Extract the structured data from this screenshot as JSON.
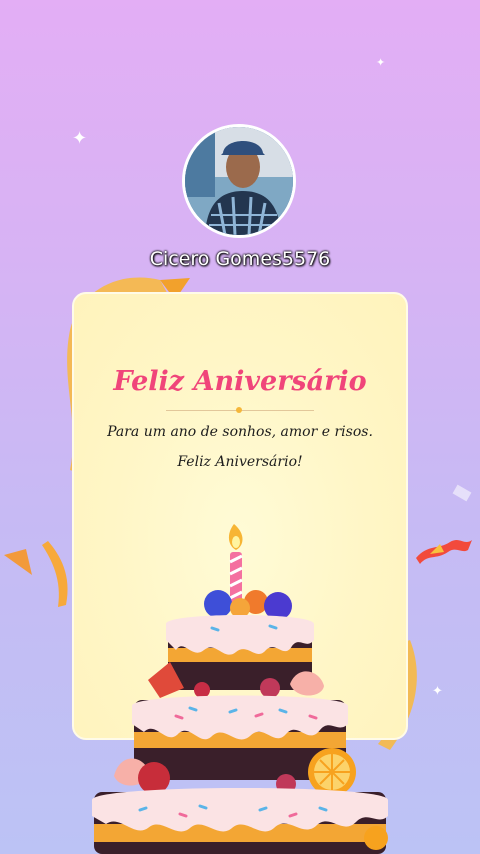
{
  "profile": {
    "username": "Cicero Gomes5576"
  },
  "card": {
    "title": "Feliz Aniversário",
    "message_line1": "Para um ano de sonhos, amor e risos.",
    "message_line2": "Feliz Aniversário!"
  },
  "colors": {
    "title": "#f0457a",
    "background_top": "#e3aef5",
    "background_bottom": "#bcc3f5",
    "card": "#fff6c6"
  }
}
